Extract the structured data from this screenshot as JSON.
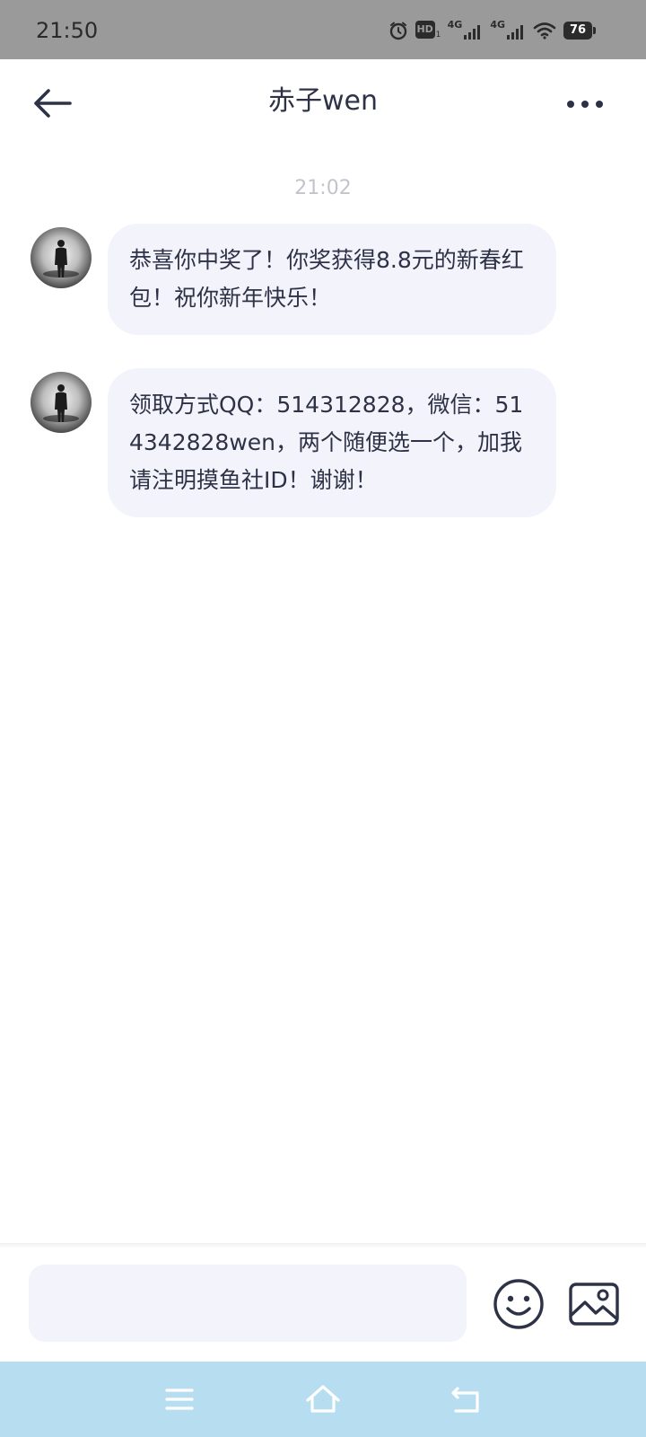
{
  "status_bar": {
    "time": "21:50",
    "hd_label": "HD",
    "hd_sub": "1",
    "network1_label": "4G",
    "network2_label": "4G",
    "battery_level": "76",
    "icons": [
      "alarm-icon",
      "hd-icon",
      "signal-icon",
      "signal-icon",
      "wifi-icon",
      "battery-icon"
    ]
  },
  "header": {
    "title": "赤子wen",
    "back_icon": "arrow-left-icon",
    "more_icon": "more-dots-icon"
  },
  "chat": {
    "timestamp": "21:02",
    "messages": [
      {
        "sender": "赤子wen",
        "text": "恭喜你中奖了！你奖获得8.8元的新春红包！祝你新年快乐！"
      },
      {
        "sender": "赤子wen",
        "text": "领取方式QQ：514312828，微信：514342828wen，两个随便选一个，加我请注明摸鱼社ID！谢谢！"
      }
    ]
  },
  "input_bar": {
    "value": "",
    "placeholder": "",
    "emoji_icon": "smiley-icon",
    "image_icon": "image-icon"
  },
  "nav_bar": {
    "icons": [
      "menu-icon",
      "home-icon",
      "back-icon"
    ],
    "background_color": "#b7ddf0"
  },
  "colors": {
    "text_primary": "#2e3247",
    "bubble_background": "#f3f4fb",
    "timestamp": "#c2c4cc",
    "status_bar": "#9a9a9a"
  }
}
